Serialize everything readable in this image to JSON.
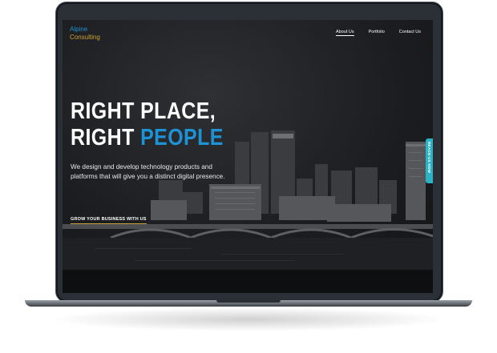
{
  "logo": {
    "line1": "Alpine",
    "line2": "Consulting"
  },
  "nav": {
    "items": [
      {
        "label": "About Us",
        "active": true
      },
      {
        "label": "Portfolio",
        "active": false
      },
      {
        "label": "Contact Us",
        "active": false
      }
    ]
  },
  "hero": {
    "headline_line1": "RIGHT PLACE,",
    "headline_line2_white": "RIGHT",
    "headline_line2_blue": "PEOPLE",
    "subhead": "We design and develop technology products and platforms that will give you a distinct digital presence.",
    "cta": "GROW YOUR BUSINESS WITH US"
  },
  "side_tab": {
    "label": "REACH US NOW"
  },
  "colors": {
    "accent_blue": "#1d93d6",
    "logo_gold": "#c9a23a",
    "tab_teal": "#2bb3c4"
  }
}
